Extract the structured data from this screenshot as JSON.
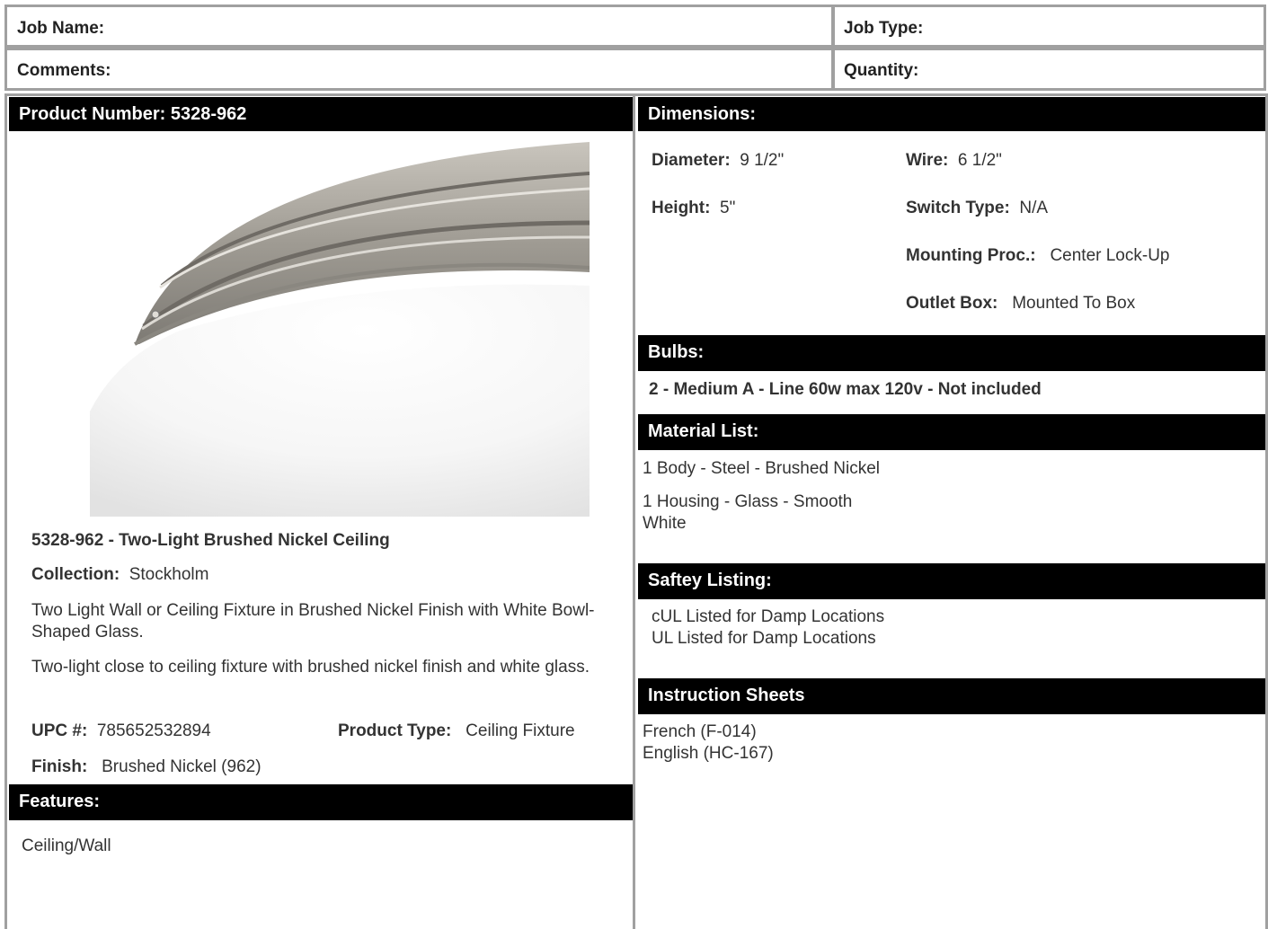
{
  "header": {
    "job_name_label": "Job Name:",
    "job_type_label": "Job Type:",
    "comments_label": "Comments:",
    "quantity_label": "Quantity:"
  },
  "product": {
    "number_heading": "Product Number: 5328-962",
    "title": "5328-962 - Two-Light Brushed Nickel Ceiling",
    "collection_label": "Collection:",
    "collection_value": "Stockholm",
    "description_1": "Two Light Wall or Ceiling Fixture in Brushed Nickel Finish with White Bowl-Shaped Glass.",
    "description_2": "Two-light close to ceiling fixture with brushed nickel finish and white glass.",
    "upc_label": "UPC #:",
    "upc_value": "785652532894",
    "type_label": "Product Type:",
    "type_value": "Ceiling Fixture",
    "finish_label": "Finish:",
    "finish_value": "Brushed Nickel (962)"
  },
  "features": {
    "heading": "Features:",
    "text": "Ceiling/Wall"
  },
  "dimensions": {
    "heading": "Dimensions:",
    "diameter_label": "Diameter:",
    "diameter_value": "9 1/2\"",
    "wire_label": "Wire:",
    "wire_value": "6 1/2\"",
    "height_label": "Height:",
    "height_value": "5\"",
    "switch_label": "Switch Type:",
    "switch_value": "N/A",
    "mounting_label": "Mounting Proc.:",
    "mounting_value": "Center Lock-Up",
    "outlet_label": "Outlet Box:",
    "outlet_value": "Mounted To Box"
  },
  "bulbs": {
    "heading": "Bulbs:",
    "text": "2 - Medium A - Line 60w max 120v - Not included"
  },
  "materials": {
    "heading": "Material List:",
    "item_1": "1 Body - Steel - Brushed Nickel",
    "item_2": "1 Housing - Glass - Smooth White"
  },
  "safety": {
    "heading": "Saftey Listing:",
    "line_1": "cUL Listed for Damp Locations",
    "line_2": "UL Listed for Damp Locations"
  },
  "instructions": {
    "heading": "Instruction Sheets",
    "line_1": "French (F-014)",
    "line_2": "English (HC-167)"
  }
}
